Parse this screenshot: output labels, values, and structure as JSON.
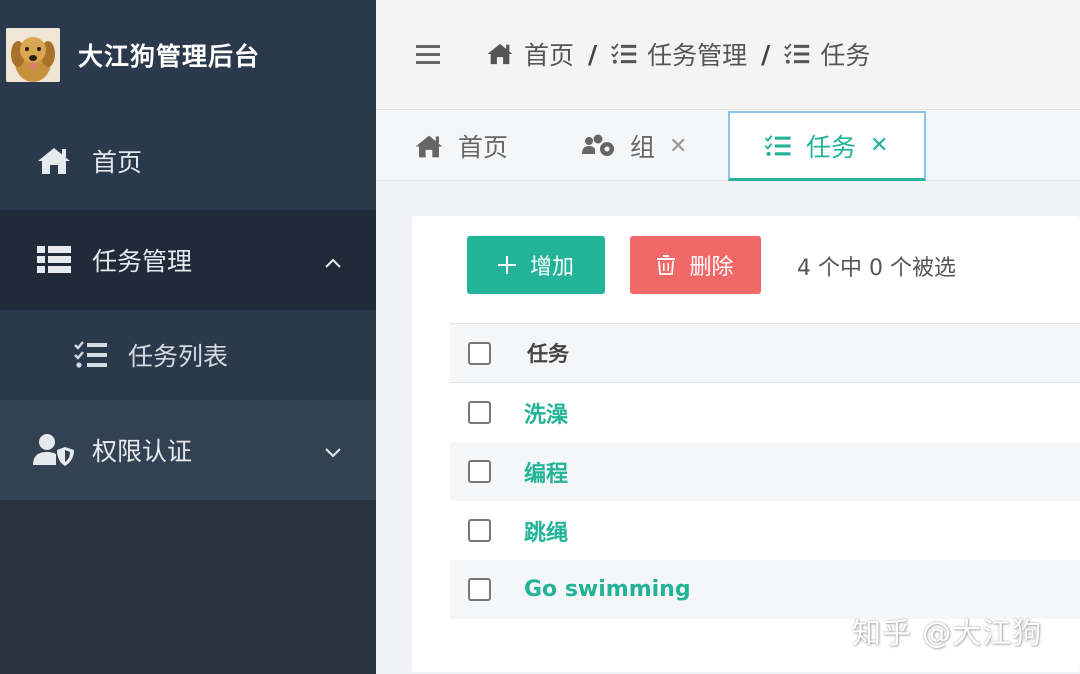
{
  "brand": {
    "title": "大江狗管理后台"
  },
  "sidebar": {
    "items": [
      {
        "label": "首页",
        "icon": "home-icon"
      },
      {
        "label": "任务管理",
        "icon": "list-icon",
        "expanded": true
      },
      {
        "label": "任务列表",
        "icon": "tasks-icon",
        "sub": true
      },
      {
        "label": "权限认证",
        "icon": "user-shield-icon",
        "expanded": false
      }
    ]
  },
  "breadcrumb": {
    "items": [
      {
        "label": "首页",
        "icon": "home-icon"
      },
      {
        "label": "任务管理",
        "icon": "tasks-icon"
      },
      {
        "label": "任务",
        "icon": "tasks-icon"
      }
    ],
    "separator": "/"
  },
  "tabs": [
    {
      "label": "首页",
      "icon": "home-icon",
      "closable": false,
      "active": false
    },
    {
      "label": "组",
      "icon": "users-cog-icon",
      "closable": true,
      "active": false
    },
    {
      "label": "任务",
      "icon": "tasks-icon",
      "closable": true,
      "active": true
    }
  ],
  "toolbar": {
    "add_label": "增加",
    "delete_label": "删除",
    "selection_text": "4 个中 0 个被选"
  },
  "table": {
    "header": "任务",
    "rows": [
      "洗澡",
      "编程",
      "跳绳",
      "Go swimming"
    ]
  },
  "watermark": "知乎 @大江狗",
  "colors": {
    "sidebar_bg": "#2a3a4c",
    "accent": "#22b398",
    "danger": "#f06868",
    "active_tab_border": "#8cc4ef"
  }
}
